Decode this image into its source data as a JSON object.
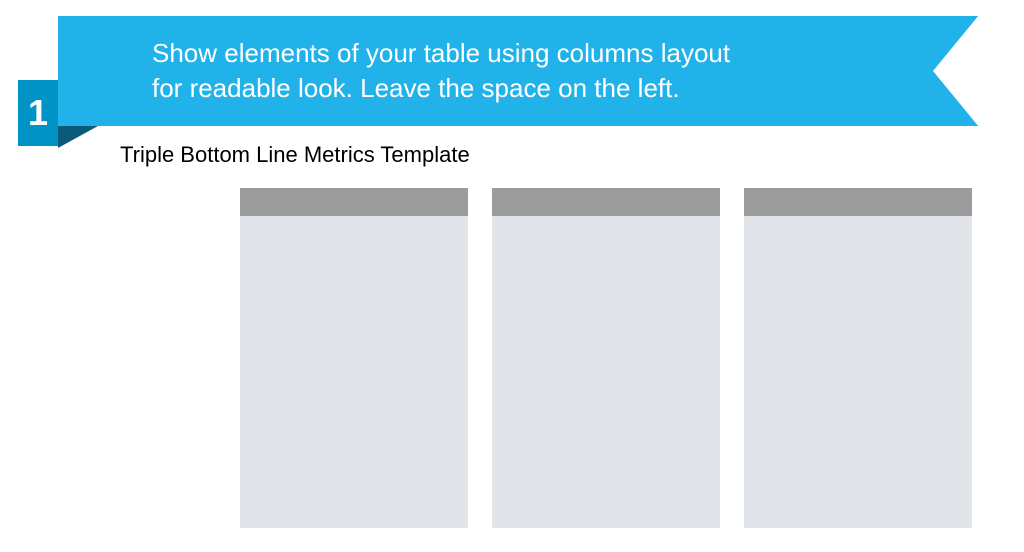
{
  "step_number": "1",
  "banner_text_line1": "Show elements of your table using columns layout",
  "banner_text_line2": "for readable look. Leave the space on the left.",
  "subtitle": "Triple Bottom Line Metrics Template",
  "columns": [
    {
      "header": "",
      "body": ""
    },
    {
      "header": "",
      "body": ""
    },
    {
      "header": "",
      "body": ""
    }
  ],
  "colors": {
    "banner": "#22b2ea",
    "step_badge": "#0094c6",
    "fold": "#0a5a7a",
    "column_header": "#9c9c9c",
    "column_body": "#e1e4e8"
  }
}
